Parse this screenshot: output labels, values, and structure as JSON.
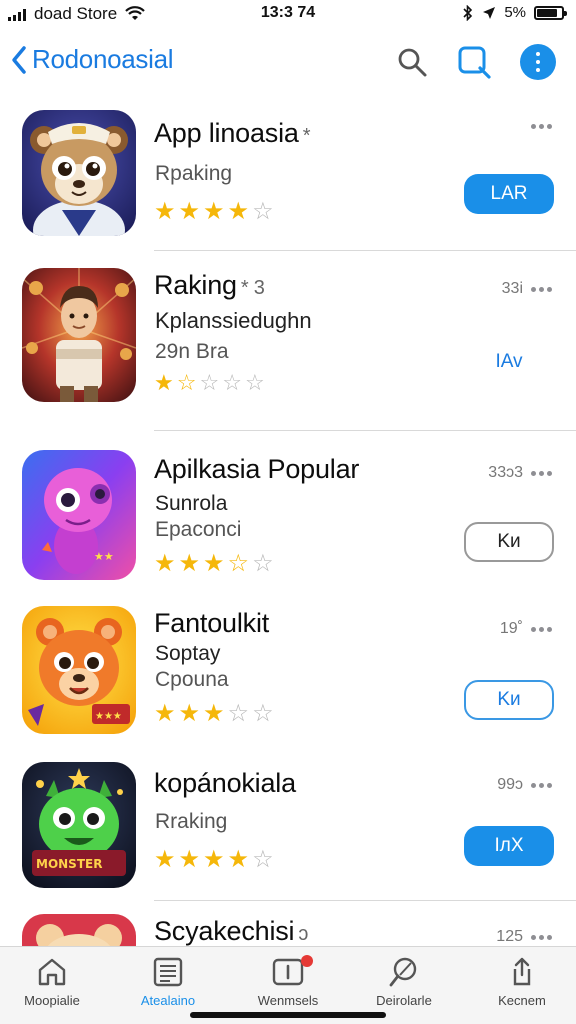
{
  "status_bar": {
    "carrier": "doad Store",
    "time": "13:3 74",
    "battery": "5%",
    "battery_level": 0.85
  },
  "header": {
    "back_title": "Rodonoasial"
  },
  "apps": [
    {
      "name": "App linoasia",
      "suffix": "*",
      "line1": "Rpaking",
      "line2": "",
      "rating": 4,
      "count": "",
      "button": "LAR",
      "button_style": "solid"
    },
    {
      "name": "Raking",
      "suffix": "* 3",
      "line1": "Kplanssiedughn",
      "line2": "29n Bra",
      "rating": 1.5,
      "count": "33i",
      "button": "IAv",
      "button_style": "text"
    },
    {
      "name": "Apilkasia Popular",
      "suffix": "",
      "line1": "Sunrola",
      "line2": "Epaconci",
      "rating": 3.5,
      "count": "33ɔ3",
      "button": "Kи",
      "button_style": "outline-gray"
    },
    {
      "name": "Fantoulkit",
      "suffix": "",
      "line1": "Soptay",
      "line2": "Cpouna",
      "rating": 3,
      "count": "19˚",
      "button": "Kи",
      "button_style": "outline-blue"
    },
    {
      "name": "kopánokiala",
      "suffix": "",
      "line1": "Rraking",
      "line2": "",
      "rating": 4,
      "count": "99ɔ",
      "button": "IлX",
      "button_style": "solid"
    },
    {
      "name": "Scyakechisi",
      "suffix": "ɔ",
      "line1": "",
      "line2": "",
      "rating": 0,
      "count": "125",
      "button": "",
      "button_style": ""
    }
  ],
  "tabs": [
    {
      "label": "Moopialie",
      "icon": "home-icon",
      "active": false
    },
    {
      "label": "Atealaino",
      "icon": "news-icon",
      "active": true
    },
    {
      "label": "Wenmsels",
      "icon": "inbox-icon",
      "active": false
    },
    {
      "label": "Deirolarle",
      "icon": "search-icon",
      "active": false
    },
    {
      "label": "Kecnem",
      "icon": "share-icon",
      "active": false
    }
  ],
  "colors": {
    "accent": "#1a8fe8",
    "star": "#f5b70a"
  }
}
